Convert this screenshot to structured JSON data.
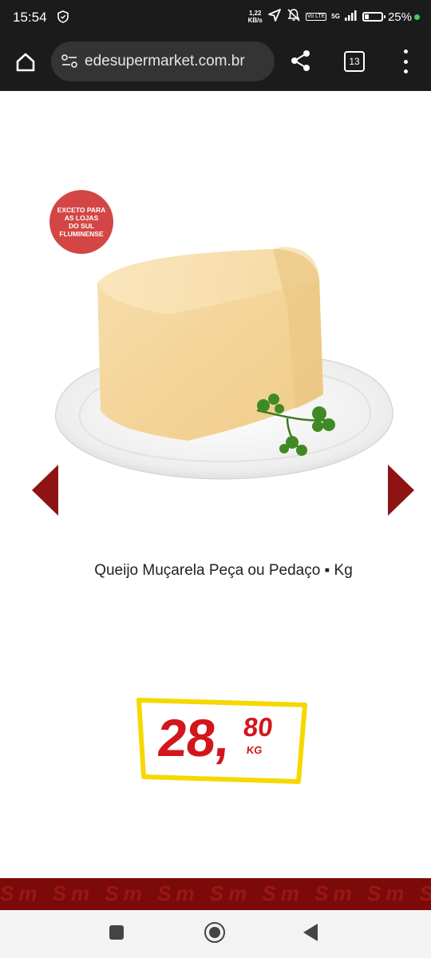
{
  "status": {
    "time": "15:54",
    "net_speed_value": "1,22",
    "net_speed_unit": "KB/s",
    "volte": "Vo LTE",
    "network": "5G",
    "battery_percent": "25%",
    "battery_level": 0.25,
    "colors": {
      "bar": "#1b1b1b",
      "dot": "#3ecf58"
    }
  },
  "browser": {
    "url": "edesupermarket.com.br",
    "tab_count": "13"
  },
  "product": {
    "badge_lines": [
      "EXCETO PARA",
      "AS LOJAS",
      "DO SUL",
      "FLUMINENSE"
    ],
    "title": "Queijo Muçarela Peça ou Pedaço ▪ Kg",
    "price": {
      "integer": "28,",
      "cents": "80",
      "unit": "KG"
    },
    "colors": {
      "price": "#d2161b",
      "tag_border": "#f5d800",
      "arrow": "#8e1313",
      "badge": "#d44646"
    }
  },
  "footer": {
    "pattern_text": "Sm Sm Sm Sm Sm Sm Sm Sm Sm Sm",
    "color": "#7d0a0a"
  },
  "icons": {
    "home": "home-icon",
    "site_settings": "site-settings-icon",
    "share": "share-icon",
    "tabs": "tabs-icon",
    "menu": "more-vert-icon"
  }
}
